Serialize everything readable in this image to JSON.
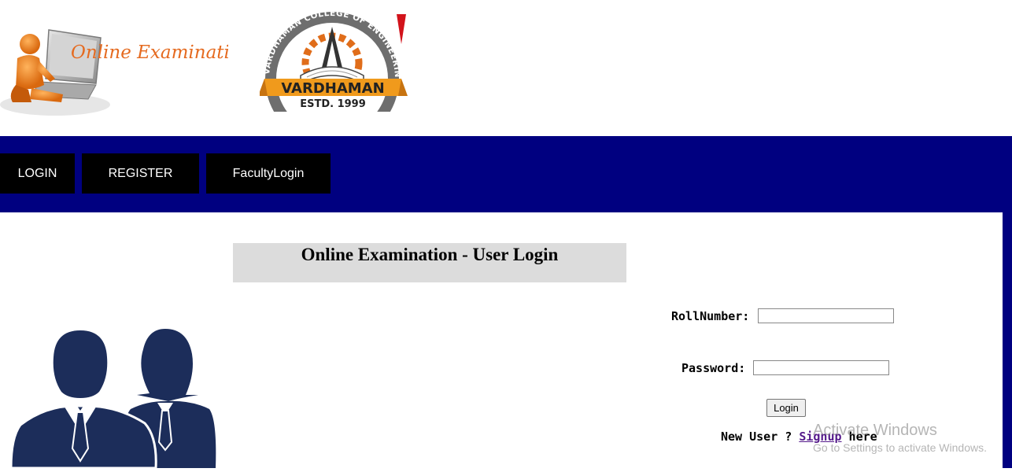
{
  "header": {
    "logo_text": "Online Examination",
    "college": {
      "arc_text": "VARDHAMAN COLLEGE OF ENGINEERING",
      "banner": "VARDHAMAN",
      "estd": "ESTD. 1999"
    }
  },
  "nav": {
    "items": [
      {
        "label": "LOGIN"
      },
      {
        "label": "REGISTER"
      },
      {
        "label": "FacultyLogin"
      }
    ]
  },
  "main": {
    "title": "Online Examination - User Login",
    "roll_label": "RollNumber:",
    "roll_value": "",
    "password_label": "Password:",
    "password_value": "",
    "login_button": "Login",
    "signup_prefix": "New User ? ",
    "signup_link": "Signup",
    "signup_suffix": " here"
  },
  "watermark": {
    "line1": "Activate Windows",
    "line2": "Go to Settings to activate Windows."
  },
  "colors": {
    "nav_bg": "#000080",
    "nav_button": "#000000",
    "title_bg": "#dcdcdc",
    "people_icon": "#1c2d5a",
    "logo_text": "#e56a1f"
  }
}
